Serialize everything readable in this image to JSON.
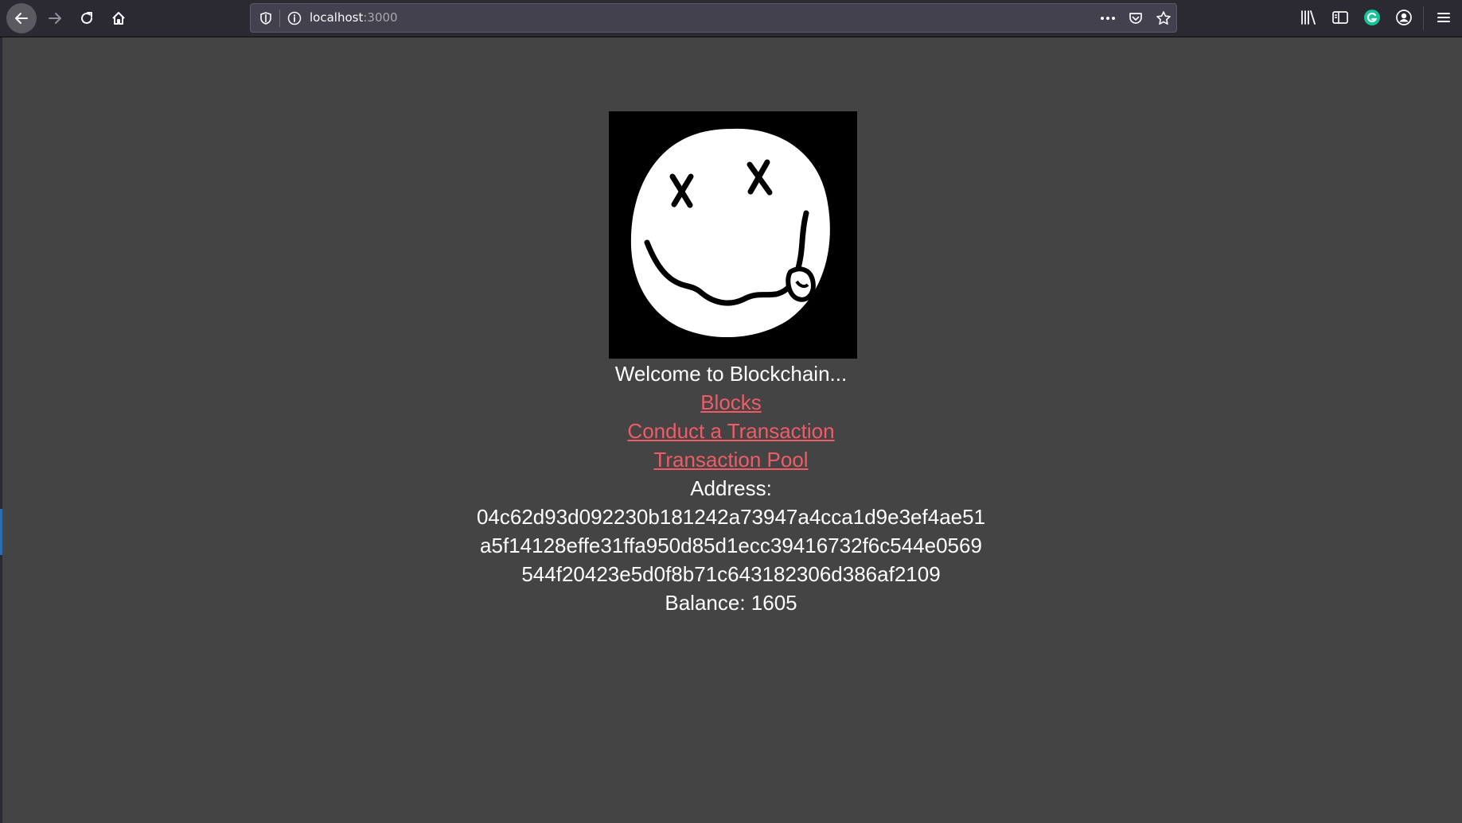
{
  "browser": {
    "url_host": "localhost",
    "url_port": ":3000"
  },
  "page": {
    "welcome": "Welcome to Blockchain...",
    "links": [
      {
        "label": "Blocks"
      },
      {
        "label": "Conduct a Transaction"
      },
      {
        "label": "Transaction Pool"
      }
    ],
    "address_label": "Address:",
    "address_lines": [
      "04c62d93d092230b181242a73947a4cca1d9e3ef4ae51",
      "a5f14128effe31ffa950d85d1ecc39416732f6c544e0569",
      "544f20423e5d0f8b71c643182306d386af2109"
    ],
    "balance": "Balance: 1605"
  },
  "colors": {
    "page_background": "#444444",
    "link": "#ef5c67",
    "text": "#ffffff",
    "toolbar": "#2b2a33"
  },
  "icons": [
    "back-icon",
    "forward-icon",
    "reload-icon",
    "home-icon",
    "shield-icon",
    "info-icon",
    "more-icon",
    "pocket-icon",
    "star-icon",
    "library-icon",
    "sidebar-icon",
    "grammarly-icon",
    "account-icon",
    "menu-icon",
    "smiley-logo"
  ]
}
